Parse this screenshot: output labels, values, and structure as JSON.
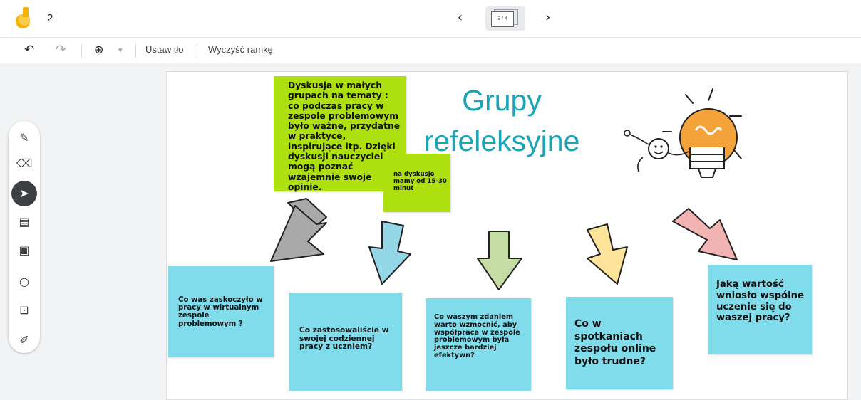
{
  "topbar": {
    "doc_number": "2",
    "frame_indicator": "3 / 4",
    "prev_label": "‹",
    "next_label": "›"
  },
  "toolbar": {
    "undo_icon": "undo-icon",
    "redo_icon": "redo-icon",
    "zoom_icon": "zoom-in-icon",
    "zoom_dropdown": "▾",
    "set_background": "Ustaw tło",
    "clear_frame": "Wyczyść ramkę"
  },
  "palette": {
    "tools": [
      "pen-icon",
      "eraser-icon",
      "select-icon",
      "sticky-note-icon",
      "image-icon",
      "circle-icon",
      "text-box-icon",
      "laser-icon"
    ],
    "active_tool": "select-icon"
  },
  "canvas": {
    "title_line1": "Grupy",
    "title_line2": "refeleksyjne",
    "title_color": "#19a5b8",
    "note_green_main": "Dyskusja w małych grupach na tematy : co podczas pracy w zespole problemowym było ważne, przydatne w praktyce, inspirujące itp. Dzięki dyskusji nauczyciele mogą poznać wzajemnie swoje opinie.",
    "note_green_small": "na dyskusję mamy od 15-30 minut",
    "notes": [
      "Co was zaskoczyło w pracy w wirtualnym zespole problemowym ?",
      "Co zastosowaliście w swojej codziennej pracy z uczniem?",
      "Co waszym zdaniem warto wzmocnić, aby współpraca w zespole problemowym była jeszcze bardziej efektywn?",
      "Co w spotkaniach zespołu online było trudne?",
      "Jaką wartość wniosło wspólne uczenie się do waszej pracy?"
    ],
    "arrow_colors": [
      "#a9a9a9",
      "#94d8e8",
      "#c6dca5",
      "#fde49a",
      "#f2b3b3"
    ],
    "note_colors": {
      "green": "#aee00f",
      "cyan": "#80dbea"
    }
  }
}
